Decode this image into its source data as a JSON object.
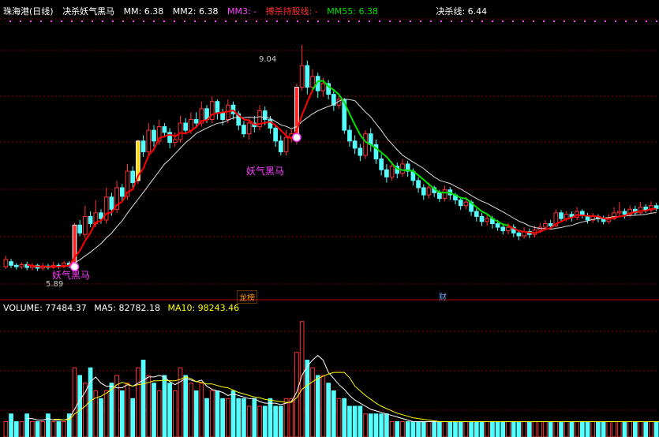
{
  "header": {
    "stock": "珠海港(日线)",
    "indicator": "决杀妖气黑马",
    "mm": "MM: 6.38",
    "mm2": "MM2: 6.38",
    "mm3": "MM3: -",
    "bosha": "搏杀持股线: -",
    "mm55": "MM55: 6.38",
    "juesha": "决杀线: 6.44"
  },
  "volume_header": {
    "volume": "VOLUME: 77484.37",
    "ma5": "MA5: 82782.18",
    "ma10": "MA10: 98243.46"
  },
  "annotations": {
    "high_label": "9.04",
    "low_label": "5.89",
    "signal1": "妖气黑马",
    "signal2": "妖气黑马",
    "tag_longhu": "龙榜",
    "tag_cai": "财"
  },
  "colors": {
    "up": "#ff3232",
    "down": "#54ffff",
    "ma_white": "#dddddd",
    "ma_red": "#ff0000",
    "ma_green": "#00e000",
    "ma_yellow": "#ffff00",
    "grid": "#8b0000",
    "signal": "#ff40ff"
  },
  "chart_data": {
    "type": "candlestick",
    "price_ylim": [
      5.6,
      9.4
    ],
    "volume_ylim": [
      0,
      160000
    ],
    "price_high": 9.04,
    "price_low": 5.89,
    "candles": [
      [
        5.95,
        6.05,
        6.1,
        5.92,
        0
      ],
      [
        6.02,
        5.97,
        6.06,
        5.93,
        0
      ],
      [
        5.97,
        5.95,
        6.0,
        5.91,
        0
      ],
      [
        5.95,
        5.98,
        6.01,
        5.92,
        0
      ],
      [
        5.98,
        5.94,
        6.02,
        5.9,
        0
      ],
      [
        5.94,
        5.97,
        6.0,
        5.9,
        0
      ],
      [
        5.97,
        5.93,
        5.99,
        5.89,
        0
      ],
      [
        5.93,
        5.96,
        6.0,
        5.9,
        0
      ],
      [
        5.96,
        5.94,
        5.99,
        5.91,
        0
      ],
      [
        5.94,
        5.97,
        6.02,
        5.92,
        0
      ],
      [
        5.97,
        5.95,
        6.0,
        5.92,
        0
      ],
      [
        5.95,
        6.0,
        6.03,
        5.93,
        0
      ],
      [
        6.0,
        5.96,
        6.03,
        5.93,
        0
      ],
      [
        5.97,
        6.53,
        6.56,
        5.95,
        1
      ],
      [
        6.53,
        6.42,
        6.6,
        6.38,
        0
      ],
      [
        6.4,
        6.65,
        6.8,
        6.35,
        0
      ],
      [
        6.65,
        6.55,
        6.72,
        6.5,
        0
      ],
      [
        6.55,
        6.7,
        6.88,
        6.5,
        0
      ],
      [
        6.7,
        6.62,
        6.75,
        6.55,
        0
      ],
      [
        6.6,
        6.92,
        7.05,
        6.55,
        0
      ],
      [
        6.92,
        6.75,
        6.98,
        6.66,
        0
      ],
      [
        6.75,
        7.05,
        7.15,
        6.7,
        0
      ],
      [
        7.05,
        6.93,
        7.1,
        6.86,
        0
      ],
      [
        6.93,
        7.28,
        7.38,
        6.88,
        0
      ],
      [
        7.28,
        7.12,
        7.35,
        7.05,
        0
      ],
      [
        7.15,
        7.7,
        7.72,
        7.1,
        1
      ],
      [
        7.7,
        7.55,
        7.78,
        7.48,
        0
      ],
      [
        7.55,
        7.85,
        7.95,
        7.5,
        0
      ],
      [
        7.85,
        7.7,
        7.92,
        7.62,
        0
      ],
      [
        7.7,
        7.9,
        8.0,
        7.65,
        0
      ],
      [
        7.9,
        7.82,
        7.95,
        7.75,
        0
      ],
      [
        7.82,
        7.68,
        7.88,
        7.6,
        0
      ],
      [
        7.68,
        7.72,
        7.82,
        7.62,
        0
      ],
      [
        7.72,
        7.95,
        8.05,
        7.68,
        0
      ],
      [
        7.95,
        7.85,
        8.02,
        7.8,
        0
      ],
      [
        7.85,
        8.0,
        8.1,
        7.8,
        0
      ],
      [
        8.0,
        7.95,
        8.1,
        7.88,
        0
      ],
      [
        7.95,
        8.15,
        8.25,
        7.9,
        0
      ],
      [
        8.15,
        8.0,
        8.2,
        7.95,
        0
      ],
      [
        8.0,
        8.25,
        8.32,
        7.95,
        0
      ],
      [
        8.25,
        8.1,
        8.28,
        8.0,
        0
      ],
      [
        8.1,
        8.0,
        8.15,
        7.92,
        0
      ],
      [
        8.0,
        8.2,
        8.28,
        7.95,
        0
      ],
      [
        8.2,
        8.08,
        8.25,
        8.0,
        0
      ],
      [
        8.08,
        7.92,
        8.12,
        7.85,
        0
      ],
      [
        7.92,
        7.8,
        7.98,
        7.75,
        0
      ],
      [
        7.8,
        7.95,
        8.02,
        7.72,
        0
      ],
      [
        7.95,
        7.9,
        8.05,
        7.82,
        0
      ],
      [
        7.9,
        8.12,
        8.2,
        7.85,
        0
      ],
      [
        8.12,
        8.0,
        8.18,
        7.92,
        0
      ],
      [
        8.0,
        7.88,
        8.05,
        7.8,
        0
      ],
      [
        7.88,
        7.7,
        7.92,
        7.62,
        0
      ],
      [
        7.7,
        7.55,
        7.78,
        7.5,
        0
      ],
      [
        7.55,
        7.75,
        7.85,
        7.5,
        0
      ],
      [
        7.75,
        7.8,
        7.88,
        7.68,
        0
      ],
      [
        7.7,
        8.45,
        8.5,
        7.65,
        1
      ],
      [
        8.45,
        8.75,
        9.04,
        8.4,
        0
      ],
      [
        8.75,
        8.45,
        8.82,
        8.35,
        0
      ],
      [
        8.45,
        8.6,
        8.7,
        8.38,
        0
      ],
      [
        8.6,
        8.4,
        8.65,
        8.3,
        0
      ],
      [
        8.4,
        8.5,
        8.58,
        8.32,
        0
      ],
      [
        8.5,
        8.35,
        8.55,
        8.28,
        0
      ],
      [
        8.35,
        8.2,
        8.4,
        8.12,
        0
      ],
      [
        8.2,
        8.28,
        8.35,
        8.15,
        0
      ],
      [
        8.28,
        7.85,
        8.3,
        7.8,
        0
      ],
      [
        7.85,
        7.7,
        7.92,
        7.62,
        0
      ],
      [
        7.7,
        7.6,
        7.78,
        7.52,
        0
      ],
      [
        7.6,
        7.5,
        7.66,
        7.42,
        0
      ],
      [
        7.5,
        7.8,
        7.85,
        7.45,
        0
      ],
      [
        7.8,
        7.65,
        7.88,
        7.55,
        0
      ],
      [
        7.65,
        7.45,
        7.72,
        7.38,
        0
      ],
      [
        7.45,
        7.3,
        7.52,
        7.22,
        0
      ],
      [
        7.3,
        7.2,
        7.38,
        7.12,
        0
      ],
      [
        7.2,
        7.35,
        7.42,
        7.15,
        0
      ],
      [
        7.35,
        7.25,
        7.4,
        7.18,
        0
      ],
      [
        7.25,
        7.38,
        7.45,
        7.2,
        0
      ],
      [
        7.38,
        7.28,
        7.42,
        7.2,
        0
      ],
      [
        7.28,
        7.15,
        7.32,
        7.08,
        0
      ],
      [
        7.15,
        7.05,
        7.2,
        6.98,
        0
      ],
      [
        7.05,
        6.95,
        7.1,
        6.88,
        0
      ],
      [
        6.95,
        7.05,
        7.12,
        6.9,
        0
      ],
      [
        7.05,
        6.98,
        7.08,
        6.92,
        0
      ],
      [
        6.98,
        6.9,
        7.02,
        6.85,
        0
      ],
      [
        6.9,
        7.02,
        7.08,
        6.86,
        0
      ],
      [
        7.02,
        6.95,
        7.06,
        6.88,
        0
      ],
      [
        6.95,
        6.88,
        6.98,
        6.82,
        0
      ],
      [
        6.88,
        6.8,
        6.92,
        6.74,
        0
      ],
      [
        6.8,
        6.85,
        6.92,
        6.75,
        0
      ],
      [
        6.85,
        6.72,
        6.88,
        6.66,
        0
      ],
      [
        6.72,
        6.65,
        6.76,
        6.58,
        0
      ],
      [
        6.65,
        6.58,
        6.7,
        6.52,
        0
      ],
      [
        6.58,
        6.62,
        6.68,
        6.52,
        0
      ],
      [
        6.62,
        6.55,
        6.66,
        6.48,
        0
      ],
      [
        6.55,
        6.5,
        6.6,
        6.45,
        0
      ],
      [
        6.5,
        6.45,
        6.55,
        6.4,
        0
      ],
      [
        6.45,
        6.5,
        6.56,
        6.4,
        0
      ],
      [
        6.5,
        6.42,
        6.54,
        6.36,
        0
      ],
      [
        6.42,
        6.38,
        6.46,
        6.32,
        0
      ],
      [
        6.38,
        6.44,
        6.5,
        6.34,
        0
      ],
      [
        6.44,
        6.4,
        6.48,
        6.35,
        0
      ],
      [
        6.4,
        6.46,
        6.52,
        6.36,
        0
      ],
      [
        6.46,
        6.5,
        6.56,
        6.42,
        0
      ],
      [
        6.5,
        6.55,
        6.6,
        6.46,
        0
      ],
      [
        6.55,
        6.52,
        6.6,
        6.47,
        0
      ],
      [
        6.52,
        6.7,
        6.75,
        6.5,
        0
      ],
      [
        6.7,
        6.62,
        6.74,
        6.58,
        0
      ],
      [
        6.62,
        6.68,
        6.72,
        6.58,
        0
      ],
      [
        6.68,
        6.64,
        6.72,
        6.58,
        0
      ],
      [
        6.64,
        6.72,
        6.78,
        6.6,
        0
      ],
      [
        6.72,
        6.66,
        6.75,
        6.62,
        0
      ],
      [
        6.66,
        6.6,
        6.7,
        6.55,
        0
      ],
      [
        6.6,
        6.65,
        6.7,
        6.56,
        0
      ],
      [
        6.65,
        6.62,
        6.68,
        6.57,
        0
      ],
      [
        6.62,
        6.58,
        6.66,
        6.54,
        0
      ],
      [
        6.58,
        6.62,
        6.68,
        6.55,
        0
      ],
      [
        6.62,
        6.7,
        6.78,
        6.6,
        0
      ],
      [
        6.7,
        6.72,
        6.85,
        6.66,
        0
      ],
      [
        6.72,
        6.68,
        6.76,
        6.62,
        0
      ],
      [
        6.68,
        6.75,
        6.8,
        6.64,
        0
      ],
      [
        6.75,
        6.7,
        6.8,
        6.66,
        0
      ],
      [
        6.7,
        6.78,
        6.85,
        6.68,
        0
      ],
      [
        6.78,
        6.74,
        6.82,
        6.7,
        0
      ],
      [
        6.74,
        6.8,
        6.86,
        6.7,
        0
      ],
      [
        6.8,
        6.76,
        6.84,
        6.72,
        0
      ]
    ],
    "volumes": [
      2,
      3,
      2,
      2,
      3,
      2,
      2,
      2,
      3,
      2,
      2,
      2,
      3,
      9,
      8,
      7,
      9,
      6,
      5,
      6,
      7,
      8,
      6,
      7,
      5,
      9,
      10,
      8,
      7,
      6,
      8,
      7,
      6,
      9,
      8,
      7,
      6,
      7,
      5,
      6,
      6,
      5,
      5,
      6,
      5,
      5,
      4,
      5,
      4,
      4,
      5,
      4,
      4,
      5,
      5,
      11,
      15,
      10,
      9,
      8,
      8,
      7,
      6,
      5,
      5,
      4,
      4,
      4,
      3,
      3,
      3,
      3,
      3,
      2,
      2,
      2,
      2,
      2,
      2,
      2,
      2,
      2,
      2,
      2,
      2,
      2,
      2,
      2,
      2,
      2,
      2,
      2,
      2,
      2,
      2,
      2,
      2,
      2,
      2,
      2,
      2,
      2,
      2,
      2,
      2,
      2,
      2,
      2,
      2,
      2,
      2,
      2,
      2,
      2,
      2,
      2,
      2,
      2,
      2,
      2,
      2,
      2,
      2,
      2,
      2,
      2,
      2,
      2
    ]
  }
}
